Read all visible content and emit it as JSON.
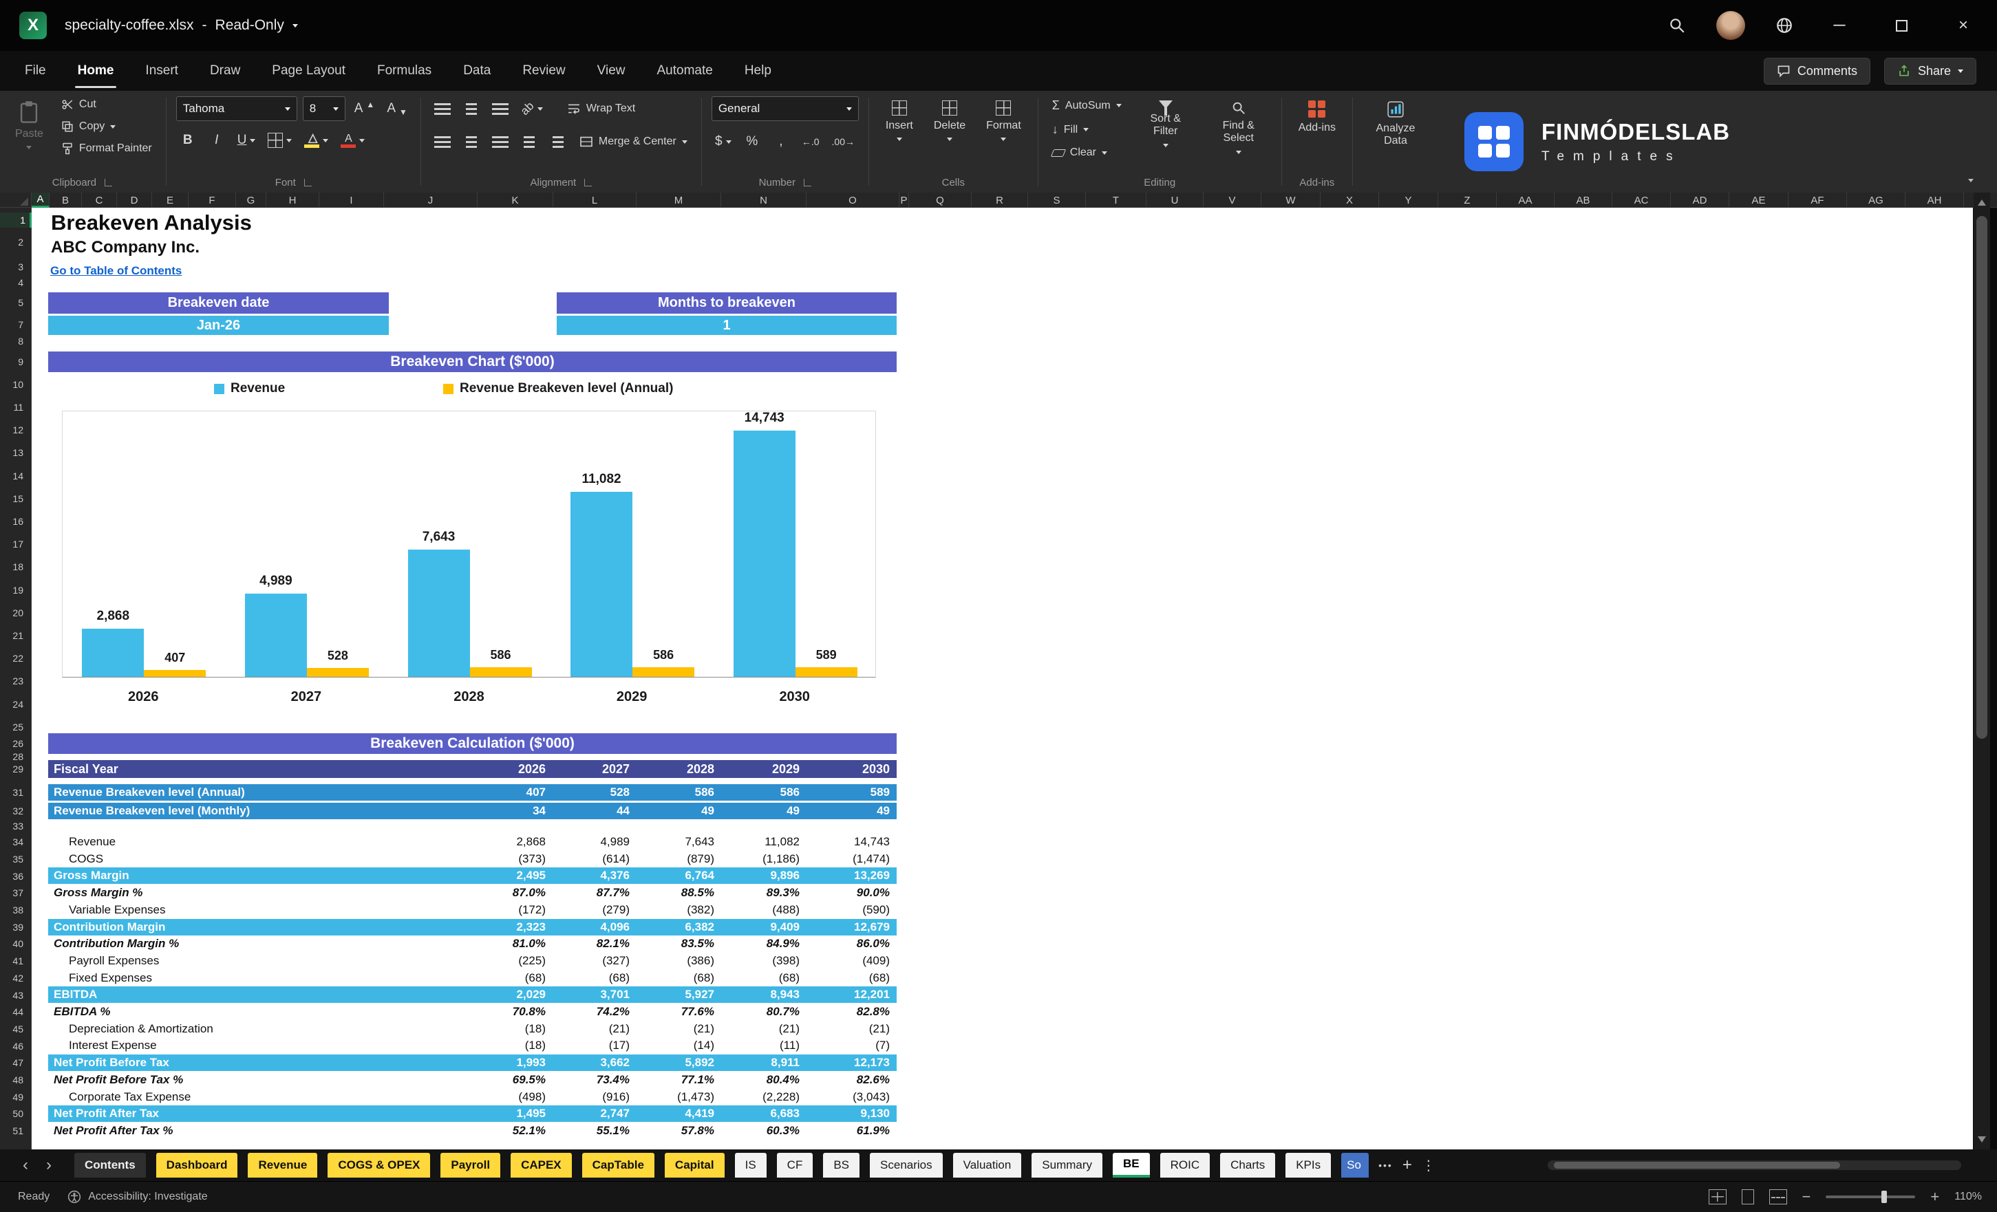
{
  "colors": {
    "purple": "#5A5FC7",
    "cyan": "#3EB7E5",
    "deep_blue": "#2E8FCF",
    "indigo": "#424996",
    "tab_yellow": "#FFD83B",
    "link": "#0F62CF"
  },
  "titlebar": {
    "filename": "specialty-coffee.xlsx",
    "dash": "-",
    "mode": "Read-Only"
  },
  "menubar": {
    "tabs": [
      "File",
      "Home",
      "Insert",
      "Draw",
      "Page Layout",
      "Formulas",
      "Data",
      "Review",
      "View",
      "Automate",
      "Help"
    ],
    "active_tab": "Home",
    "comments_label": "Comments",
    "share_label": "Share"
  },
  "ribbon": {
    "clipboard": {
      "group_label": "Clipboard",
      "paste_label": "Paste",
      "cut_label": "Cut",
      "copy_label": "Copy",
      "format_painter_label": "Format Painter"
    },
    "font": {
      "group_label": "Font",
      "font_name": "Tahoma",
      "font_size": "8",
      "bold": "B",
      "italic": "I",
      "underline": "U"
    },
    "alignment": {
      "group_label": "Alignment",
      "wrap_text_label": "Wrap Text",
      "merge_center_label": "Merge & Center",
      "orientation_glyph": "ab"
    },
    "number": {
      "group_label": "Number",
      "format_value": "General",
      "currency": "$",
      "percent": "%",
      "comma": ",",
      "increase_decimal": "←.0",
      "decrease_decimal": ".00→"
    },
    "cells": {
      "group_label": "Cells",
      "insert_label": "Insert",
      "delete_label": "Delete",
      "format_label": "Format"
    },
    "editing": {
      "group_label": "Editing",
      "autosum_label": "AutoSum",
      "autosum_glyph": "Σ",
      "fill_label": "Fill",
      "fill_glyph": "↓",
      "clear_label": "Clear",
      "sort_filter_label": "Sort & Filter",
      "find_select_label": "Find & Select"
    },
    "addins": {
      "group_label": "Add-ins",
      "addins_label": "Add-ins",
      "analyze_label": "Analyze Data"
    }
  },
  "brand": {
    "name": "FINMÓDELSLAB",
    "tagline": "Templates"
  },
  "sheet": {
    "title": "Breakeven Analysis",
    "company": "ABC Company Inc.",
    "link": "Go to Table of Contents",
    "chart_header": "Breakeven Chart ($'000)",
    "calc_header": "Breakeven Calculation ($'000)",
    "summary_boxes": [
      {
        "title": "Breakeven date",
        "value": "Jan-26"
      },
      {
        "title": "Months to breakeven",
        "value": "1"
      }
    ]
  },
  "chart_data": {
    "type": "bar",
    "title": "Breakeven Chart ($'000)",
    "categories": [
      "2026",
      "2027",
      "2028",
      "2029",
      "2030"
    ],
    "series": [
      {
        "name": "Revenue",
        "color": "#41BCE8",
        "values": [
          2868,
          4989,
          7643,
          11082,
          14743
        ],
        "labels": [
          "2,868",
          "4,989",
          "7,643",
          "11,082",
          "14,743"
        ]
      },
      {
        "name": "Revenue Breakeven level (Annual)",
        "color": "#FFC000",
        "values": [
          407,
          528,
          586,
          586,
          589
        ],
        "labels": [
          "407",
          "528",
          "586",
          "586",
          "589"
        ]
      }
    ],
    "ylim": [
      0,
      16000
    ],
    "grid": false,
    "legend_position": "top"
  },
  "calc_table": {
    "header": {
      "label": "Fiscal Year",
      "years": [
        "2026",
        "2027",
        "2028",
        "2029",
        "2030"
      ]
    },
    "breakeven_rows": [
      {
        "label": "Revenue Breakeven level (Annual)",
        "values": [
          "407",
          "528",
          "586",
          "586",
          "589"
        ]
      },
      {
        "label": "Revenue Breakeven level (Monthly)",
        "values": [
          "34",
          "44",
          "49",
          "49",
          "49"
        ]
      }
    ],
    "rows": [
      {
        "label": "Revenue",
        "values": [
          "2,868",
          "4,989",
          "7,643",
          "11,082",
          "14,743"
        ],
        "style": "plain"
      },
      {
        "label": "COGS",
        "values": [
          "(373)",
          "(614)",
          "(879)",
          "(1,186)",
          "(1,474)"
        ],
        "style": "plain"
      },
      {
        "label": "Gross Margin",
        "values": [
          "2,495",
          "4,376",
          "6,764",
          "9,896",
          "13,269"
        ],
        "style": "highlight"
      },
      {
        "label": "Gross Margin %",
        "values": [
          "87.0%",
          "87.7%",
          "88.5%",
          "89.3%",
          "90.0%"
        ],
        "style": "percent"
      },
      {
        "label": "Variable Expenses",
        "values": [
          "(172)",
          "(279)",
          "(382)",
          "(488)",
          "(590)"
        ],
        "style": "plain"
      },
      {
        "label": "Contribution Margin",
        "values": [
          "2,323",
          "4,096",
          "6,382",
          "9,409",
          "12,679"
        ],
        "style": "highlight"
      },
      {
        "label": "Contribution Margin %",
        "values": [
          "81.0%",
          "82.1%",
          "83.5%",
          "84.9%",
          "86.0%"
        ],
        "style": "percent"
      },
      {
        "label": "Payroll Expenses",
        "values": [
          "(225)",
          "(327)",
          "(386)",
          "(398)",
          "(409)"
        ],
        "style": "plain"
      },
      {
        "label": "Fixed Expenses",
        "values": [
          "(68)",
          "(68)",
          "(68)",
          "(68)",
          "(68)"
        ],
        "style": "plain"
      },
      {
        "label": "EBITDA",
        "values": [
          "2,029",
          "3,701",
          "5,927",
          "8,943",
          "12,201"
        ],
        "style": "highlight"
      },
      {
        "label": "EBITDA %",
        "values": [
          "70.8%",
          "74.2%",
          "77.6%",
          "80.7%",
          "82.8%"
        ],
        "style": "percent"
      },
      {
        "label": "Depreciation & Amortization",
        "values": [
          "(18)",
          "(21)",
          "(21)",
          "(21)",
          "(21)"
        ],
        "style": "plain"
      },
      {
        "label": "Interest Expense",
        "values": [
          "(18)",
          "(17)",
          "(14)",
          "(11)",
          "(7)"
        ],
        "style": "plain"
      },
      {
        "label": "Net Profit Before Tax",
        "values": [
          "1,993",
          "3,662",
          "5,892",
          "8,911",
          "12,173"
        ],
        "style": "highlight"
      },
      {
        "label": "Net Profit Before Tax %",
        "values": [
          "69.5%",
          "73.4%",
          "77.1%",
          "80.4%",
          "82.6%"
        ],
        "style": "percent"
      },
      {
        "label": "Corporate Tax Expense",
        "values": [
          "(498)",
          "(916)",
          "(1,473)",
          "(2,228)",
          "(3,043)"
        ],
        "style": "plain"
      },
      {
        "label": "Net Profit After Tax",
        "values": [
          "1,495",
          "2,747",
          "4,419",
          "6,683",
          "9,130"
        ],
        "style": "highlight"
      },
      {
        "label": "Net Profit After Tax %",
        "values": [
          "52.1%",
          "55.1%",
          "57.8%",
          "60.3%",
          "61.9%"
        ],
        "style": "percent"
      }
    ]
  },
  "grid": {
    "col_labels": [
      "A",
      "B",
      "C",
      "D",
      "E",
      "F",
      "G",
      "H",
      "I",
      "J",
      "K",
      "L",
      "M",
      "N",
      "O",
      "P",
      "Q",
      "R",
      "S",
      "T",
      "U",
      "V",
      "W",
      "X",
      "Y",
      "Z",
      "AA",
      "AB",
      "AC",
      "AD",
      "AE",
      "AF",
      "AG",
      "AH"
    ],
    "col_edges": [
      46,
      72,
      119,
      170,
      221,
      274,
      343,
      387,
      464,
      558,
      694,
      804,
      925,
      1048,
      1172,
      1307,
      1321,
      1412,
      1494,
      1578,
      1666,
      1749,
      1833,
      1919,
      2004,
      2090,
      2175,
      2259,
      2343,
      2428,
      2513,
      2599,
      2684,
      2769,
      2854
    ],
    "selected_col": "A",
    "selected_row": 1,
    "row_numbers": [
      {
        "n": 1,
        "y": 18
      },
      {
        "n": 2,
        "y": 50
      },
      {
        "n": 3,
        "y": 86
      },
      {
        "n": 4,
        "y": 109
      },
      {
        "n": 5,
        "y": 138
      },
      {
        "n": 7,
        "y": 170
      },
      {
        "n": 8,
        "y": 194
      },
      {
        "n": 9,
        "y": 224
      },
      {
        "n": 10,
        "y": 257
      },
      {
        "n": 11,
        "y": 290
      },
      {
        "n": 12,
        "y": 323
      },
      {
        "n": 13,
        "y": 356
      },
      {
        "n": 14,
        "y": 390
      },
      {
        "n": 15,
        "y": 423
      },
      {
        "n": 16,
        "y": 456
      },
      {
        "n": 17,
        "y": 489
      },
      {
        "n": 18,
        "y": 522
      },
      {
        "n": 19,
        "y": 556
      },
      {
        "n": 20,
        "y": 589
      },
      {
        "n": 21,
        "y": 622
      },
      {
        "n": 22,
        "y": 655
      },
      {
        "n": 23,
        "y": 688
      },
      {
        "n": 24,
        "y": 722
      },
      {
        "n": 25,
        "y": 755
      },
      {
        "n": 26,
        "y": 779
      },
      {
        "n": 28,
        "y": 798
      },
      {
        "n": 29,
        "y": 816
      },
      {
        "n": 31,
        "y": 850
      },
      {
        "n": 32,
        "y": 877
      },
      {
        "n": 33,
        "y": 899
      },
      {
        "n": 34,
        "y": 922
      },
      {
        "n": 35,
        "y": 947
      },
      {
        "n": 36,
        "y": 972
      },
      {
        "n": 37,
        "y": 996
      },
      {
        "n": 38,
        "y": 1021
      },
      {
        "n": 39,
        "y": 1046
      },
      {
        "n": 40,
        "y": 1070
      },
      {
        "n": 41,
        "y": 1095
      },
      {
        "n": 42,
        "y": 1120
      },
      {
        "n": 43,
        "y": 1145
      },
      {
        "n": 44,
        "y": 1169
      },
      {
        "n": 45,
        "y": 1194
      },
      {
        "n": 46,
        "y": 1219
      },
      {
        "n": 47,
        "y": 1243
      },
      {
        "n": 48,
        "y": 1268
      },
      {
        "n": 49,
        "y": 1293
      },
      {
        "n": 50,
        "y": 1317
      },
      {
        "n": 51,
        "y": 1342
      }
    ]
  },
  "sheet_tabs": {
    "nav_prev": "‹",
    "nav_next": "›",
    "more": "•••",
    "add": "+",
    "splitter": "⋮",
    "tabs": [
      {
        "label": "Contents",
        "style": "dark"
      },
      {
        "label": "Dashboard",
        "style": "yellow"
      },
      {
        "label": "Revenue",
        "style": "yellow"
      },
      {
        "label": "COGS & OPEX",
        "style": "yellow"
      },
      {
        "label": "Payroll",
        "style": "yellow"
      },
      {
        "label": "CAPEX",
        "style": "yellow"
      },
      {
        "label": "CapTable",
        "style": "yellow"
      },
      {
        "label": "Capital",
        "style": "yellow"
      },
      {
        "label": "IS",
        "style": "white"
      },
      {
        "label": "CF",
        "style": "white"
      },
      {
        "label": "BS",
        "style": "white"
      },
      {
        "label": "Scenarios",
        "style": "white"
      },
      {
        "label": "Valuation",
        "style": "white"
      },
      {
        "label": "Summary",
        "style": "white"
      },
      {
        "label": "BE",
        "style": "active"
      },
      {
        "label": "ROIC",
        "style": "white"
      },
      {
        "label": "Charts",
        "style": "white"
      },
      {
        "label": "KPIs",
        "style": "white"
      },
      {
        "label": "So",
        "style": "bluecut"
      }
    ]
  },
  "statusbar": {
    "ready": "Ready",
    "accessibility": "Accessibility: Investigate",
    "zoom_minus": "−",
    "zoom_plus": "+",
    "zoom": "110%"
  }
}
